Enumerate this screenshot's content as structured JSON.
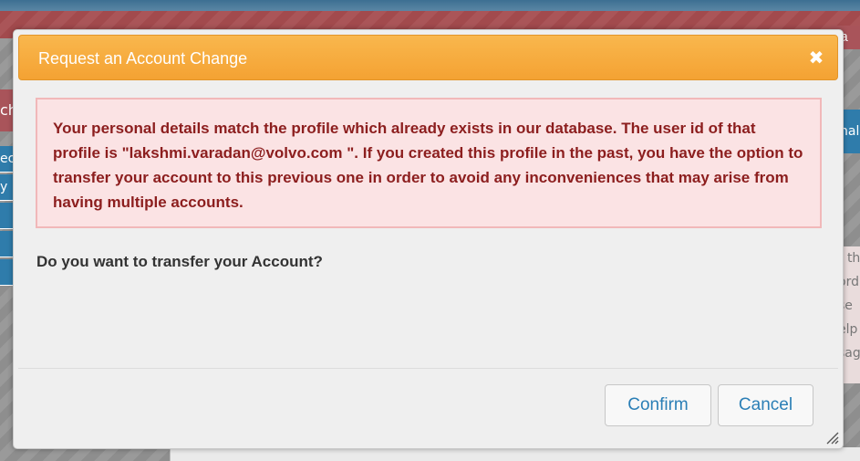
{
  "dialog": {
    "title": "Request an Account Change",
    "close_glyph": "✖",
    "alert_message": "Your personal details match the profile which already exists in our database. The user id of that profile is \"lakshmi.varadan@volvo.com \". If you created this profile in the past, you have the option to transfer your account to this previous one in order to avoid any inconveniences that may arise from having multiple accounts.",
    "question": "Do you want to transfer your Account?",
    "confirm_label": "Confirm",
    "cancel_label": "Cancel"
  },
  "background": {
    "top_right_fragment": "na",
    "left_fragments": [
      "ch",
      "ec",
      "y"
    ],
    "right_nav_fragment": "nal",
    "right_text_fragments": [
      "t th",
      "ord",
      "se",
      "elp",
      "sag"
    ]
  },
  "colors": {
    "titlebar": "#f4a233",
    "alert_bg": "#fbe3e4",
    "alert_text": "#8c1e1e",
    "button_text": "#2b7fb6"
  }
}
